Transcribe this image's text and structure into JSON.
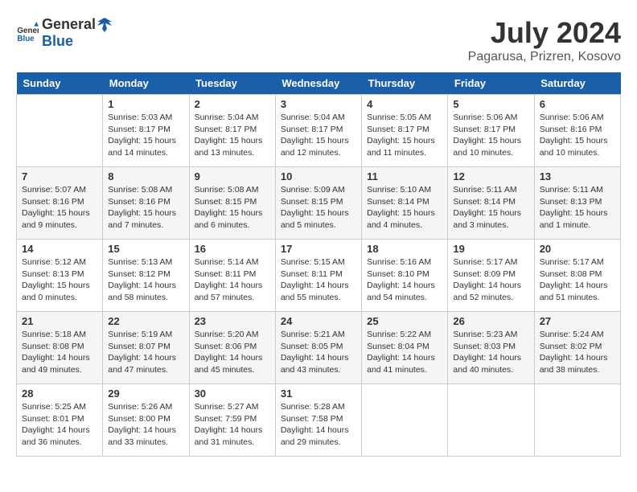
{
  "header": {
    "logo_general": "General",
    "logo_blue": "Blue",
    "month": "July 2024",
    "location": "Pagarusa, Prizren, Kosovo"
  },
  "weekdays": [
    "Sunday",
    "Monday",
    "Tuesday",
    "Wednesday",
    "Thursday",
    "Friday",
    "Saturday"
  ],
  "weeks": [
    [
      {
        "day": "",
        "info": ""
      },
      {
        "day": "1",
        "info": "Sunrise: 5:03 AM\nSunset: 8:17 PM\nDaylight: 15 hours\nand 14 minutes."
      },
      {
        "day": "2",
        "info": "Sunrise: 5:04 AM\nSunset: 8:17 PM\nDaylight: 15 hours\nand 13 minutes."
      },
      {
        "day": "3",
        "info": "Sunrise: 5:04 AM\nSunset: 8:17 PM\nDaylight: 15 hours\nand 12 minutes."
      },
      {
        "day": "4",
        "info": "Sunrise: 5:05 AM\nSunset: 8:17 PM\nDaylight: 15 hours\nand 11 minutes."
      },
      {
        "day": "5",
        "info": "Sunrise: 5:06 AM\nSunset: 8:17 PM\nDaylight: 15 hours\nand 10 minutes."
      },
      {
        "day": "6",
        "info": "Sunrise: 5:06 AM\nSunset: 8:16 PM\nDaylight: 15 hours\nand 10 minutes."
      }
    ],
    [
      {
        "day": "7",
        "info": "Sunrise: 5:07 AM\nSunset: 8:16 PM\nDaylight: 15 hours\nand 9 minutes."
      },
      {
        "day": "8",
        "info": "Sunrise: 5:08 AM\nSunset: 8:16 PM\nDaylight: 15 hours\nand 7 minutes."
      },
      {
        "day": "9",
        "info": "Sunrise: 5:08 AM\nSunset: 8:15 PM\nDaylight: 15 hours\nand 6 minutes."
      },
      {
        "day": "10",
        "info": "Sunrise: 5:09 AM\nSunset: 8:15 PM\nDaylight: 15 hours\nand 5 minutes."
      },
      {
        "day": "11",
        "info": "Sunrise: 5:10 AM\nSunset: 8:14 PM\nDaylight: 15 hours\nand 4 minutes."
      },
      {
        "day": "12",
        "info": "Sunrise: 5:11 AM\nSunset: 8:14 PM\nDaylight: 15 hours\nand 3 minutes."
      },
      {
        "day": "13",
        "info": "Sunrise: 5:11 AM\nSunset: 8:13 PM\nDaylight: 15 hours\nand 1 minute."
      }
    ],
    [
      {
        "day": "14",
        "info": "Sunrise: 5:12 AM\nSunset: 8:13 PM\nDaylight: 15 hours\nand 0 minutes."
      },
      {
        "day": "15",
        "info": "Sunrise: 5:13 AM\nSunset: 8:12 PM\nDaylight: 14 hours\nand 58 minutes."
      },
      {
        "day": "16",
        "info": "Sunrise: 5:14 AM\nSunset: 8:11 PM\nDaylight: 14 hours\nand 57 minutes."
      },
      {
        "day": "17",
        "info": "Sunrise: 5:15 AM\nSunset: 8:11 PM\nDaylight: 14 hours\nand 55 minutes."
      },
      {
        "day": "18",
        "info": "Sunrise: 5:16 AM\nSunset: 8:10 PM\nDaylight: 14 hours\nand 54 minutes."
      },
      {
        "day": "19",
        "info": "Sunrise: 5:17 AM\nSunset: 8:09 PM\nDaylight: 14 hours\nand 52 minutes."
      },
      {
        "day": "20",
        "info": "Sunrise: 5:17 AM\nSunset: 8:08 PM\nDaylight: 14 hours\nand 51 minutes."
      }
    ],
    [
      {
        "day": "21",
        "info": "Sunrise: 5:18 AM\nSunset: 8:08 PM\nDaylight: 14 hours\nand 49 minutes."
      },
      {
        "day": "22",
        "info": "Sunrise: 5:19 AM\nSunset: 8:07 PM\nDaylight: 14 hours\nand 47 minutes."
      },
      {
        "day": "23",
        "info": "Sunrise: 5:20 AM\nSunset: 8:06 PM\nDaylight: 14 hours\nand 45 minutes."
      },
      {
        "day": "24",
        "info": "Sunrise: 5:21 AM\nSunset: 8:05 PM\nDaylight: 14 hours\nand 43 minutes."
      },
      {
        "day": "25",
        "info": "Sunrise: 5:22 AM\nSunset: 8:04 PM\nDaylight: 14 hours\nand 41 minutes."
      },
      {
        "day": "26",
        "info": "Sunrise: 5:23 AM\nSunset: 8:03 PM\nDaylight: 14 hours\nand 40 minutes."
      },
      {
        "day": "27",
        "info": "Sunrise: 5:24 AM\nSunset: 8:02 PM\nDaylight: 14 hours\nand 38 minutes."
      }
    ],
    [
      {
        "day": "28",
        "info": "Sunrise: 5:25 AM\nSunset: 8:01 PM\nDaylight: 14 hours\nand 36 minutes."
      },
      {
        "day": "29",
        "info": "Sunrise: 5:26 AM\nSunset: 8:00 PM\nDaylight: 14 hours\nand 33 minutes."
      },
      {
        "day": "30",
        "info": "Sunrise: 5:27 AM\nSunset: 7:59 PM\nDaylight: 14 hours\nand 31 minutes."
      },
      {
        "day": "31",
        "info": "Sunrise: 5:28 AM\nSunset: 7:58 PM\nDaylight: 14 hours\nand 29 minutes."
      },
      {
        "day": "",
        "info": ""
      },
      {
        "day": "",
        "info": ""
      },
      {
        "day": "",
        "info": ""
      }
    ]
  ]
}
